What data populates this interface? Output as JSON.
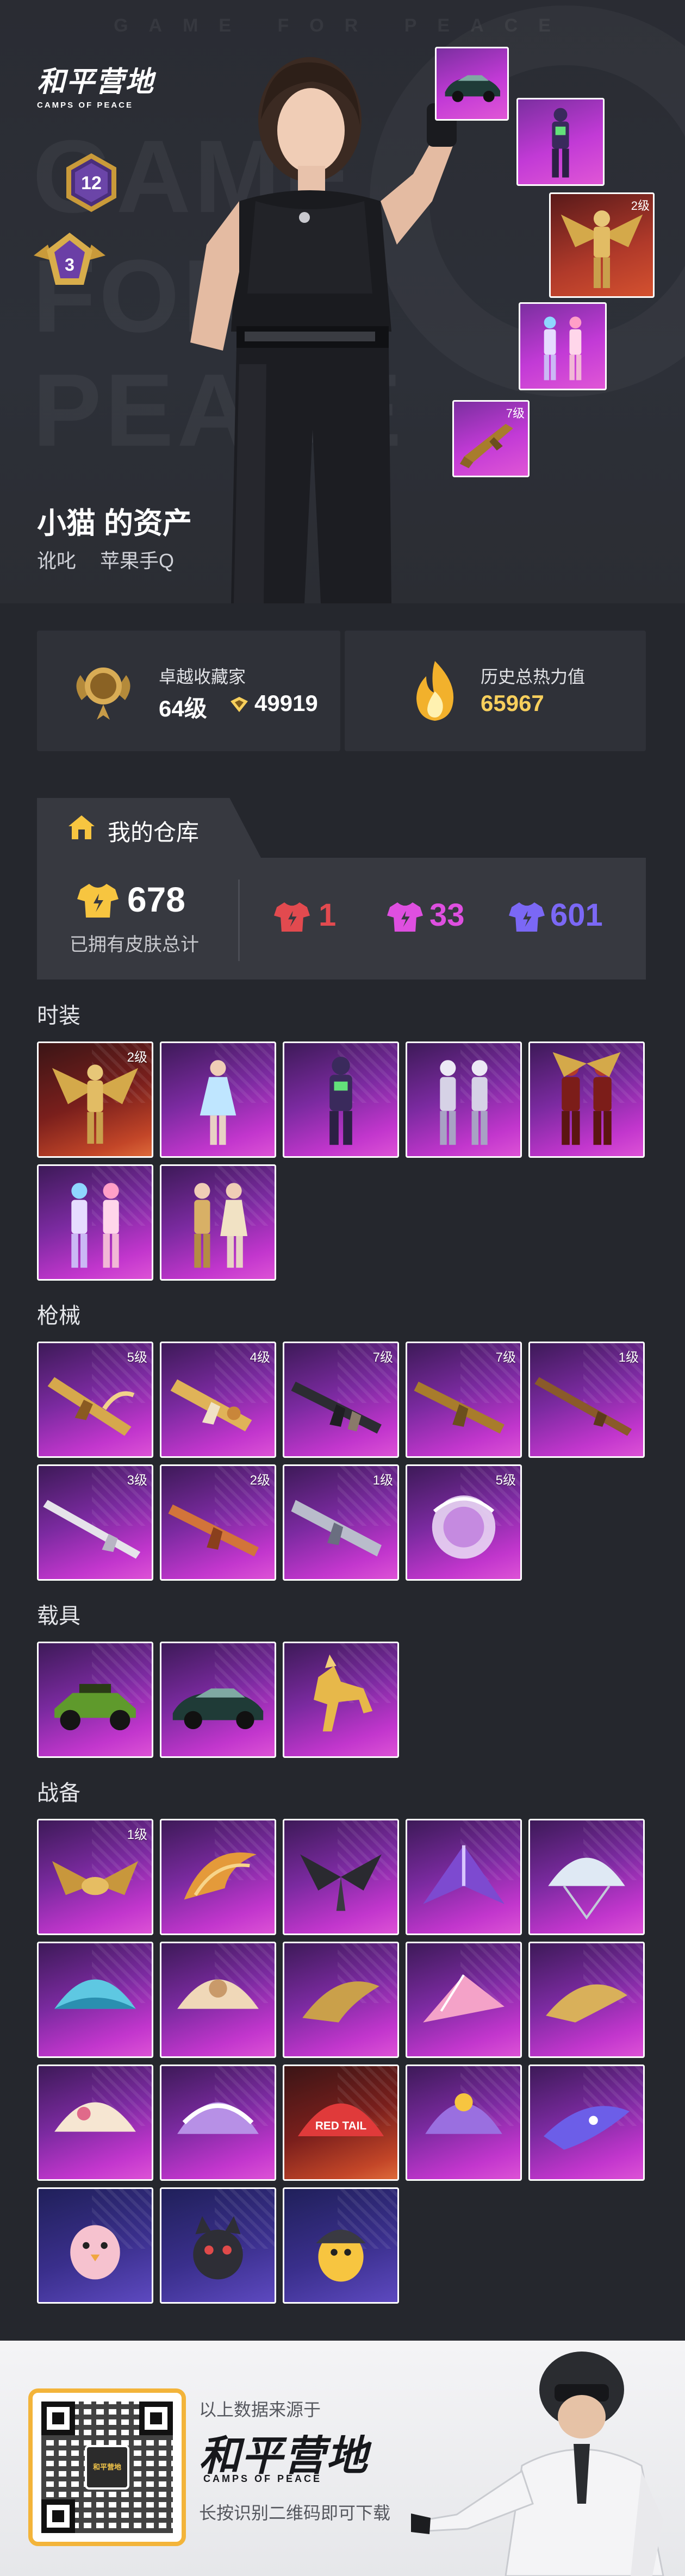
{
  "hero": {
    "tagline": "GAME FOR PEACE",
    "bg_words": [
      "GAME",
      "FOR",
      "PEACE"
    ],
    "logo_cn": "和平营地",
    "logo_en": "CAMPS OF PEACE",
    "level_badge": "12",
    "rank_badge": "3",
    "showcase_levels": [
      "2级",
      "7级"
    ]
  },
  "owner": {
    "name": "小猫 的资产",
    "nickname": "讹叱",
    "platform": "苹果手Q"
  },
  "stats": {
    "collector_title": "卓越收藏家",
    "collector_level": "64级",
    "collector_points": "49919",
    "heat_title": "历史总热力值",
    "heat_value": "65967"
  },
  "warehouse": {
    "title": "我的仓库",
    "total": "678",
    "total_label": "已拥有皮肤总计",
    "red_count": "1",
    "pink_count": "33",
    "blue_count": "601",
    "colors": {
      "red": "#e24a4f",
      "pink": "#de4fe0",
      "blue": "#7b68f5",
      "gold": "#f7cf5c"
    }
  },
  "sections": {
    "outfits": "时装",
    "guns": "枪械",
    "vehicles": "载具",
    "gear": "战备"
  },
  "outfits": [
    {
      "icon": "golden-winged-outfit-icon",
      "level": "2级"
    },
    {
      "icon": "blue-dress-outfit-icon",
      "level": ""
    },
    {
      "icon": "mecha-suit-outfit-icon",
      "level": ""
    },
    {
      "icon": "twin-silver-outfit-icon",
      "level": ""
    },
    {
      "icon": "crimson-demon-outfit-icon",
      "level": ""
    },
    {
      "icon": "pink-blue-couple-outfit-icon",
      "level": ""
    },
    {
      "icon": "gold-couple-outfit-icon",
      "level": ""
    }
  ],
  "guns": [
    {
      "icon": "golden-dragon-rifle-icon",
      "level": "5级"
    },
    {
      "icon": "gold-smg-icon",
      "level": "4级"
    },
    {
      "icon": "ak-rifle-icon",
      "level": "7级"
    },
    {
      "icon": "golden-ak-icon",
      "level": "7级"
    },
    {
      "icon": "bolt-rifle-icon",
      "level": "1级"
    },
    {
      "icon": "shotgun-icon",
      "level": "3级"
    },
    {
      "icon": "orange-rifle-icon",
      "level": "2级"
    },
    {
      "icon": "silver-rifle-icon",
      "level": "1级"
    },
    {
      "icon": "crystal-orb-icon",
      "level": "5级"
    }
  ],
  "vehicles": [
    {
      "icon": "green-buggy-icon"
    },
    {
      "icon": "sports-car-icon"
    },
    {
      "icon": "golden-horse-icon"
    }
  ],
  "gear": [
    {
      "icon": "golden-dragon-glider-icon",
      "level": "1级"
    },
    {
      "icon": "phoenix-glider-icon",
      "level": ""
    },
    {
      "icon": "dark-wing-glider-icon",
      "level": ""
    },
    {
      "icon": "purple-glider-icon",
      "level": ""
    },
    {
      "icon": "crystal-parachute-icon",
      "level": ""
    },
    {
      "icon": "cyan-parachute-icon",
      "level": ""
    },
    {
      "icon": "beige-parachute-icon",
      "level": ""
    },
    {
      "icon": "gold-wing-glider-icon",
      "level": ""
    },
    {
      "icon": "pink-glider-icon",
      "level": ""
    },
    {
      "icon": "gold-ornate-glider-icon",
      "level": ""
    },
    {
      "icon": "cream-parachute-icon",
      "level": ""
    },
    {
      "icon": "striped-parachute-icon",
      "level": ""
    },
    {
      "icon": "red-tail-parachute-icon",
      "level": ""
    },
    {
      "icon": "flower-parachute-icon",
      "level": ""
    },
    {
      "icon": "galaxy-glider-icon",
      "level": ""
    },
    {
      "icon": "pink-chick-mascot-icon",
      "level": ""
    },
    {
      "icon": "dark-cat-mascot-icon",
      "level": ""
    },
    {
      "icon": "helmet-chick-mascot-icon",
      "level": ""
    }
  ],
  "gear_print": {
    "red_tail_text": "RED TAIL"
  },
  "footer": {
    "source": "以上数据来源于",
    "logo_cn": "和平营地",
    "logo_en": "CAMPS OF PEACE",
    "qr_center": "和平营地",
    "hint": "长按识别二维码即可下载"
  }
}
